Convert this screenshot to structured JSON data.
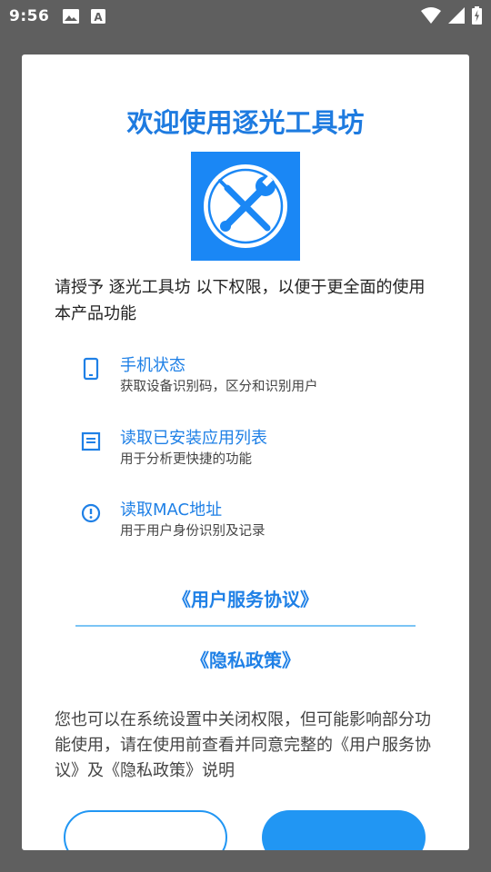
{
  "status_bar": {
    "time": "9:56",
    "left_icons": [
      "image-icon",
      "font-icon"
    ],
    "right_icons": [
      "wifi-icon",
      "signal-icon",
      "battery-icon"
    ]
  },
  "dialog": {
    "title": "欢迎使用逐光工具坊",
    "app_icon": "wrench-screwdriver-icon",
    "intro": "请授予 逐光工具坊 以下权限，以便于更全面的使用本产品功能",
    "permissions": [
      {
        "icon": "phone-icon",
        "title": "手机状态",
        "desc": "获取设备识别码，区分和识别用户"
      },
      {
        "icon": "list-icon",
        "title": "读取已安装应用列表",
        "desc": "用于分析更快捷的功能"
      },
      {
        "icon": "info-icon",
        "title": "读取MAC地址",
        "desc": "用于用户身份识别及记录"
      }
    ],
    "links": {
      "user_agreement": "《用户服务协议》",
      "privacy_policy": "《隐私政策》"
    },
    "note": "您也可以在系统设置中关闭权限，但可能影响部分功能使用，请在使用前查看并同意完整的《用户服务协议》及《隐私政策》说明"
  },
  "colors": {
    "accent": "#1f80e6",
    "title": "#1e7be0",
    "icon_bg": "#1a87f5",
    "button": "#2196f3",
    "divider": "#7bc4f5",
    "scrim": "#5f5f5f"
  }
}
